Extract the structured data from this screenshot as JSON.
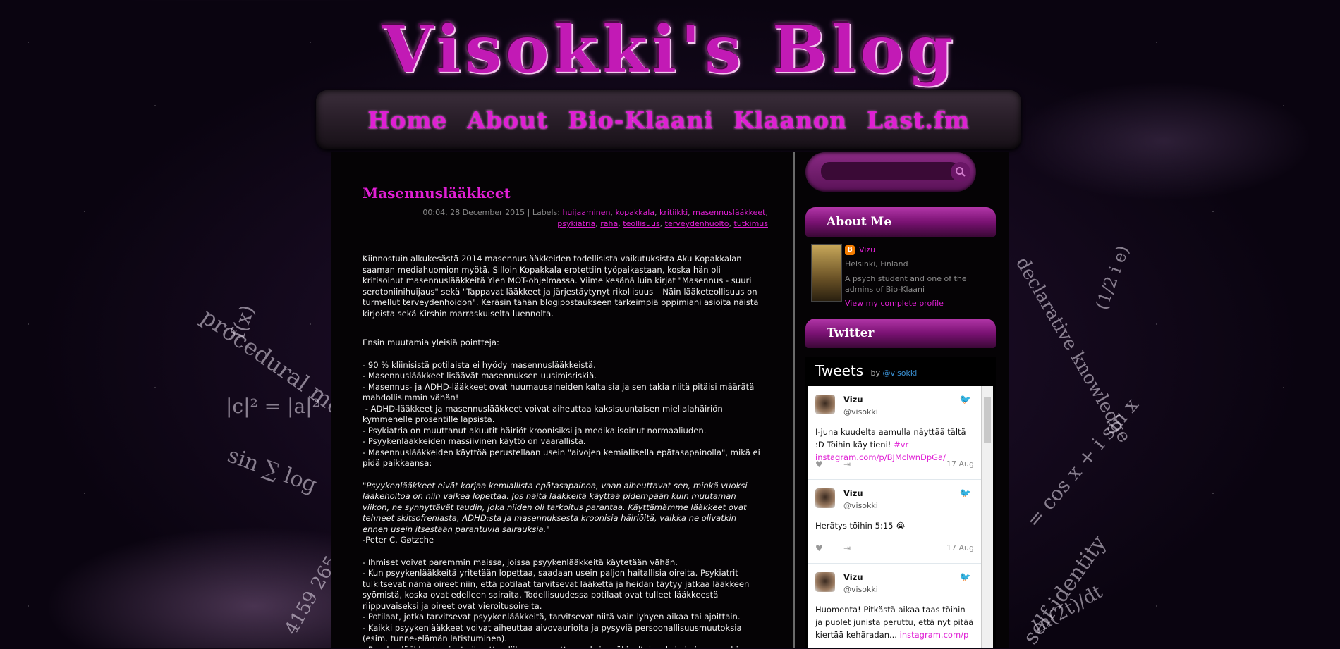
{
  "site": {
    "title": "Visokki's Blog"
  },
  "nav": [
    {
      "label": "Home"
    },
    {
      "label": "About"
    },
    {
      "label": "Bio-Klaani"
    },
    {
      "label": "Klaanon"
    },
    {
      "label": "Last.fm"
    }
  ],
  "post": {
    "title": "Masennuslääkkeet",
    "meta_prefix": "00:04, 28 December 2015 | Labels:",
    "labels": [
      "huijaaminen",
      "kopakkala",
      "kritiikki",
      "masennuslääkkeet",
      "psykiatria",
      "raha",
      "teollisuus",
      "terveydenhuolto",
      "tutkimus"
    ],
    "paragraphs": [
      "Kiinnostuin alkukesästä 2014 masennuslääkkeiden todellisista vaikutuksista Aku Kopakkalan saaman mediahuomion myötä. Silloin Kopakkala erotettiin työpaikastaan, koska hän oli kritisoinut masennuslääkkeitä Ylen MOT-ohjelmassa. Viime kesänä luin kirjat \"Masennus - suuri serotoniinihuijaus\" sekä \"Tappavat lääkkeet ja järjestäytynyt rikollisuus – Näin lääketeollisuus on turmellut terveydenhoidon\". Keräsin tähän blogipostaukseen tärkeimpiä oppimiani asioita näistä kirjoista sekä Kirshin marraskuiselta luennolta.",
      "Ensin muutamia yleisiä pointteja:",
      "- 90 % kliinisistä potilaista ei hyödy masennuslääkkeistä.\n- Masennuslääkkeet lisäävät masennuksen uusimisriskiä.\n- Masennus- ja ADHD-lääkkeet ovat huumausaineiden kaltaisia ja sen takia niitä pitäisi määrätä mahdollisimmin vähän!\n - ADHD-lääkkeet ja masennuslääkkeet voivat aiheuttaa kaksisuuntaisen mielialahäiriön kymmenelle prosentille lapsista.\n- Psykiatria on muuttanut akuutit häiriöt kroonisiksi ja medikalisoinut normaaliuden.\n- Psyykenlääkkeiden massiivinen käyttö on vaarallista.\n- Masennuslääkkeiden käyttöä perustellaan usein \"aivojen kemiallisella epätasapainolla\", mikä ei pidä paikkaansa:",
      "\"Psyykenlääkkeet eivät korjaa kemiallista epätasapainoa, vaan aiheuttavat sen, minkä vuoksi lääkehoitoa on niin vaikea lopettaa. Jos näitä lääkkeitä käyttää pidempään kuin muutaman viikon, ne synnyttävät taudin, joka niiden oli tarkoitus parantaa. Käyttämämme lääkkeet ovat tehneet skitsofreniasta, ADHD:sta ja masennuksesta kroonisia häiriöitä, vaikka ne olivatkin ennen usein itsestään parantuvia sairauksia.\"",
      "-Peter C. Gøtzche",
      "- Ihmiset voivat paremmin maissa, joissa psyykenlääkkeitä käytetään vähän.\n- Kun psyykenlääkkeitä yritetään lopettaa, saadaan usein paljon haitallisia oireita. Psykiatrit tulkitsevat nämä oireet niin, että potilaat tarvitsevat lääkettä ja heidän täytyy jatkaa lääkkeen syömistä, koska ovat edelleen sairaita. Todellisuudessa potilaat ovat tulleet lääkkeestä riippuvaiseksi ja oireet ovat vieroitusoireita.\n- Potilaat, jotka tarvitsevat psyykenlääkkeitä, tarvitsevat niitä vain lyhyen aikaa tai ajoittain.\n- Kaikki psyykenlääkkeet voivat aiheuttaa aivovaurioita ja pysyviä persoonallisuusmuutoksia (esim. tunne-elämän latistuminen).\n- Psyykenlääkkeet voivat aiheuttaa liikenneonnettomuuksia, väkivaltaisuuksia ja jopa murhia."
    ]
  },
  "search": {
    "placeholder": ""
  },
  "about": {
    "heading": "About Me",
    "name": "Vizu",
    "location": "Helsinki, Finland",
    "description": "A psych student and one of the admins of Bio-Klaani",
    "profile_link": "View my complete profile"
  },
  "twitter": {
    "heading": "Twitter",
    "tweets_label": "Tweets",
    "by_label": "by",
    "handle": "@visokki",
    "tweets": [
      {
        "name": "Vizu",
        "handle": "@visokki",
        "text": "I-juna kuudelta aamulla näyttää tältä :D Töihin käy tieni! ",
        "link": "#vr instagram.com/p/BJMclwnDpGa/",
        "date": "17 Aug"
      },
      {
        "name": "Vizu",
        "handle": "@visokki",
        "text": "Herätys töihin 5:15 😭",
        "link": "",
        "date": "17 Aug"
      },
      {
        "name": "Vizu",
        "handle": "@visokki",
        "text": "Huomenta! Pitkästä aikaa taas töihin ja puolet junista peruttu, että nyt pitää kiertää kehäradan... ",
        "link": "instagram.com/p",
        "date": ""
      }
    ]
  },
  "decor": {
    "left": [
      "procedural memory",
      "f(x)",
      "|c|² = |a|²",
      "sin ∑ log",
      "4159 265"
    ],
    "right": [
      "self-identity",
      "declarative knowledge",
      "= cos x + i sin x",
      "ln(2t)/dt",
      "(1/2 i e)"
    ]
  },
  "icons": {
    "search": "search-icon",
    "blogger": "blogger-icon",
    "bird": "twitter-bird-icon",
    "like": "heart-icon",
    "share": "share-icon"
  },
  "colors": {
    "accent": "#e01fd4",
    "background": "#050305"
  }
}
